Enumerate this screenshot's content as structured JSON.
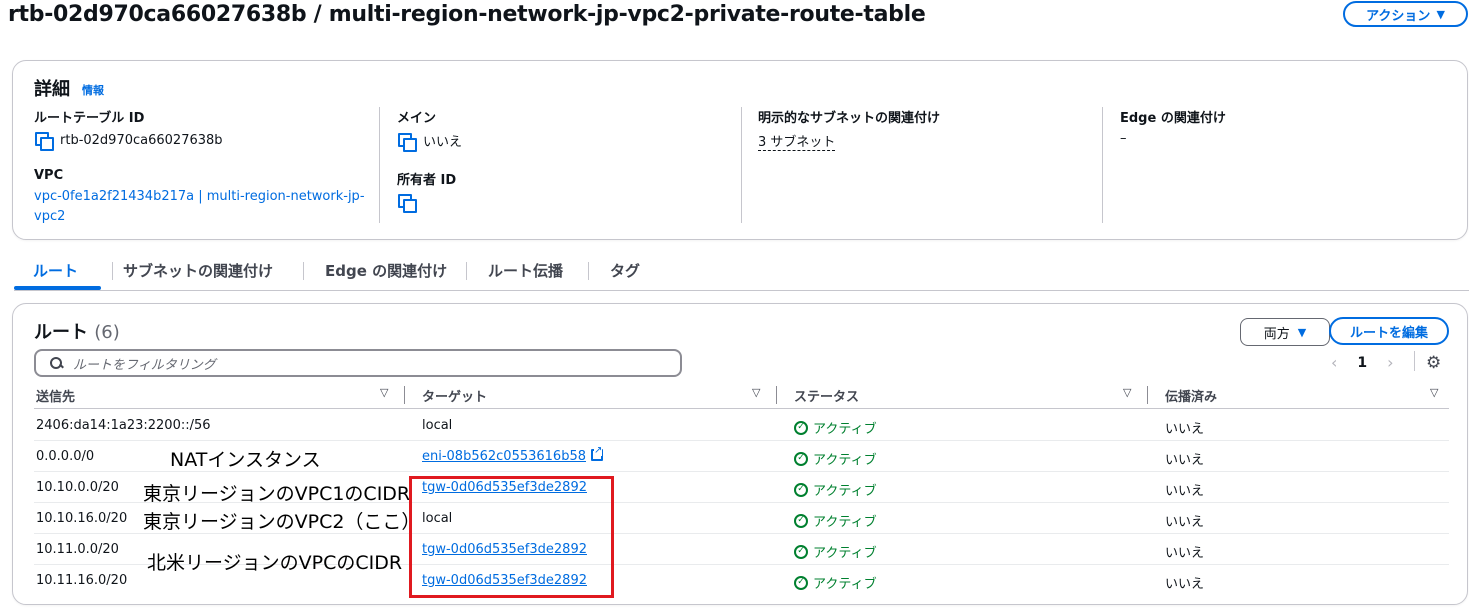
{
  "header": {
    "title": "rtb-02d970ca66027638b / multi-region-network-jp-vpc2-private-route-table",
    "action_label": "アクション"
  },
  "details": {
    "heading": "詳細",
    "info": "情報",
    "route_table_id_label": "ルートテーブル ID",
    "route_table_id": "rtb-02d970ca66027638b",
    "vpc_label": "VPC",
    "vpc_line1": "vpc-0fe1a2f21434b217a | multi-region-network-jp-",
    "vpc_line2": "vpc2",
    "main_label": "メイン",
    "main_value": "いいえ",
    "owner_label": "所有者 ID",
    "explicit_label": "明示的なサブネットの関連付け",
    "explicit_value": "3 サブネット",
    "edge_label": "Edge の関連付け",
    "edge_value": "–"
  },
  "tabs": [
    "ルート",
    "サブネットの関連付け",
    "Edge の関連付け",
    "ルート伝播",
    "タグ"
  ],
  "routes": {
    "title": "ルート",
    "count": "(6)",
    "both_label": "両方",
    "edit_label": "ルートを編集",
    "filter_placeholder": "ルートをフィルタリング",
    "page": "1",
    "columns": [
      "送信先",
      "ターゲット",
      "ステータス",
      "伝播済み"
    ],
    "rows": [
      {
        "dest": "2406:da14:1a23:2200::/56",
        "target": "local",
        "status": "アクティブ",
        "propagated": "いいえ"
      },
      {
        "dest": "0.0.0.0/0",
        "target": "eni-08b562c0553616b58",
        "status": "アクティブ",
        "propagated": "いいえ"
      },
      {
        "dest": "10.10.0.0/20",
        "target": "tgw-0d06d535ef3de2892",
        "status": "アクティブ",
        "propagated": "いいえ"
      },
      {
        "dest": "10.10.16.0/20",
        "target": "local",
        "status": "アクティブ",
        "propagated": "いいえ"
      },
      {
        "dest": "10.11.0.0/20",
        "target": "tgw-0d06d535ef3de2892",
        "status": "アクティブ",
        "propagated": "いいえ"
      },
      {
        "dest": "10.11.16.0/20",
        "target": "tgw-0d06d535ef3de2892",
        "status": "アクティブ",
        "propagated": "いいえ"
      }
    ]
  },
  "annotations": {
    "nat": "NATインスタンス",
    "tokyo_vpc1": "東京リージョンのVPC1のCIDR",
    "tokyo_vpc2": "東京リージョンのVPC2（ここ）",
    "na_vpc": "北米リージョンのVPCのCIDR",
    "highlight_color": "#e0191f"
  }
}
